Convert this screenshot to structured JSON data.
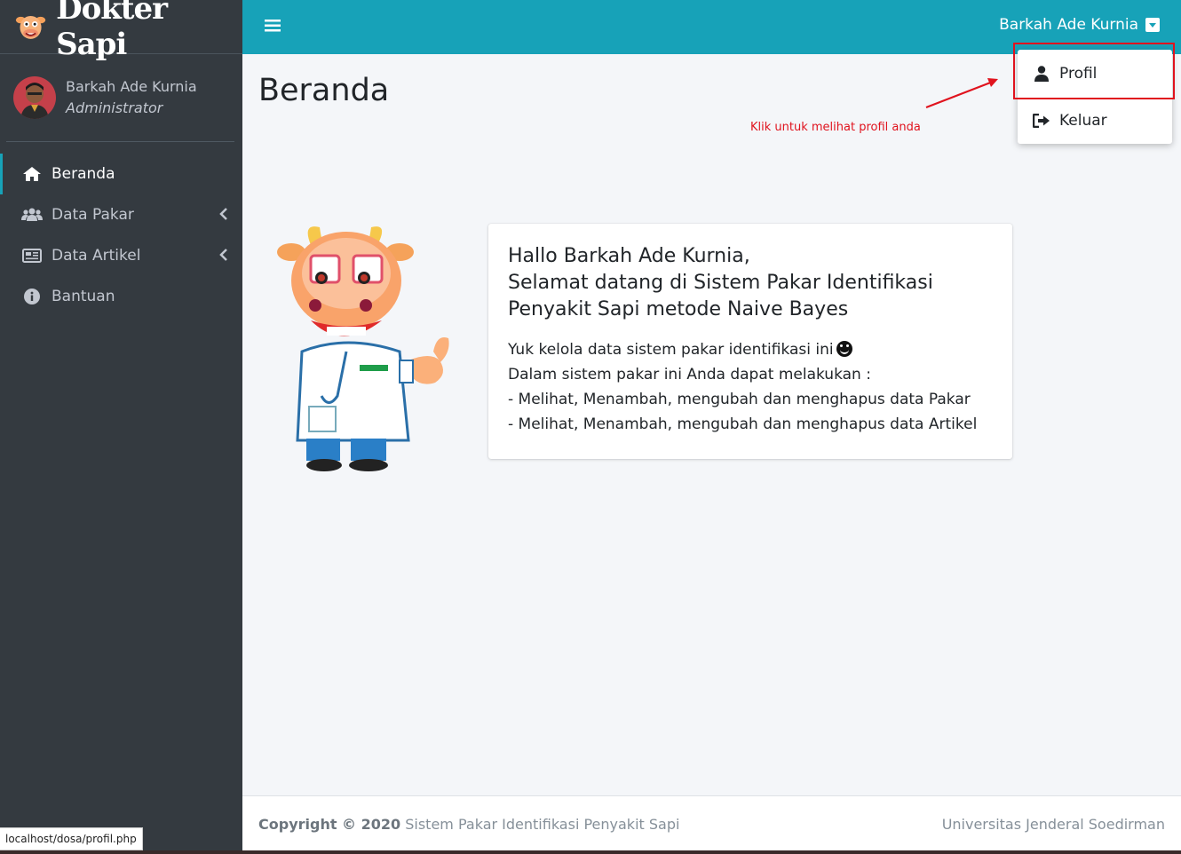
{
  "brand": {
    "name": "Dokter Sapi"
  },
  "user": {
    "name": "Barkah Ade Kurnia",
    "role": "Administrator"
  },
  "sidebar": {
    "items": [
      {
        "label": "Beranda",
        "icon": "home-icon",
        "active": true
      },
      {
        "label": "Data Pakar",
        "icon": "users-icon",
        "has_children": true
      },
      {
        "label": "Data Artikel",
        "icon": "newspaper-icon",
        "has_children": true
      },
      {
        "label": "Bantuan",
        "icon": "info-icon"
      }
    ]
  },
  "topbar": {
    "user_name": "Barkah Ade Kurnia"
  },
  "dropdown": {
    "items": [
      {
        "label": "Profil",
        "icon": "user-icon"
      },
      {
        "label": "Keluar",
        "icon": "sign-out-icon"
      }
    ]
  },
  "annotation": {
    "text": "Klik untuk melihat profil anda"
  },
  "main": {
    "title": "Beranda",
    "card": {
      "heading_line1": "Hallo Barkah Ade Kurnia,",
      "heading_line2": "Selamat datang di Sistem Pakar Identifikasi",
      "heading_line3": "Penyakit Sapi metode Naive Bayes",
      "line1": "Yuk kelola data sistem pakar identifikasi ini",
      "line2": "Dalam sistem pakar ini Anda dapat melakukan :",
      "line3": "- Melihat, Menambah, mengubah dan menghapus data Pakar",
      "line4": "- Melihat, Menambah, mengubah dan menghapus data Artikel"
    }
  },
  "footer": {
    "copyright_bold": "Copyright © 2020",
    "copyright_text": " Sistem Pakar Identifikasi Penyakit Sapi",
    "right": "Universitas Jenderal Soedirman"
  },
  "statusbar": {
    "url": "localhost/dosa/profil.php"
  },
  "colors": {
    "accent": "#17a2b8",
    "sidebar": "#343a40",
    "annotation": "#e0131e"
  }
}
